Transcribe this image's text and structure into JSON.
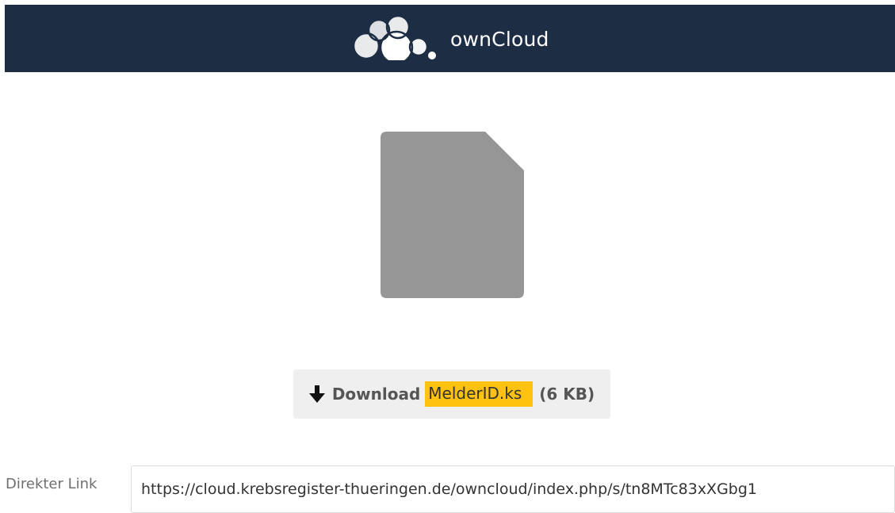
{
  "header": {
    "brand": "ownCloud",
    "background_color": "#1d2d44",
    "logo_icon": "owncloud-cloud-logo-icon"
  },
  "file_preview": {
    "icon": "file-icon",
    "color": "#969696"
  },
  "download": {
    "arrow_icon": "download-arrow-icon",
    "label": "Download",
    "filename": "MelderID.ks",
    "size": "(6 KB)",
    "highlight_color": "#ffc20e"
  },
  "direct_link": {
    "label": "Direkter Link",
    "url": "https://cloud.krebsregister-thueringen.de/owncloud/index.php/s/tn8MTc83xXGbg1"
  }
}
